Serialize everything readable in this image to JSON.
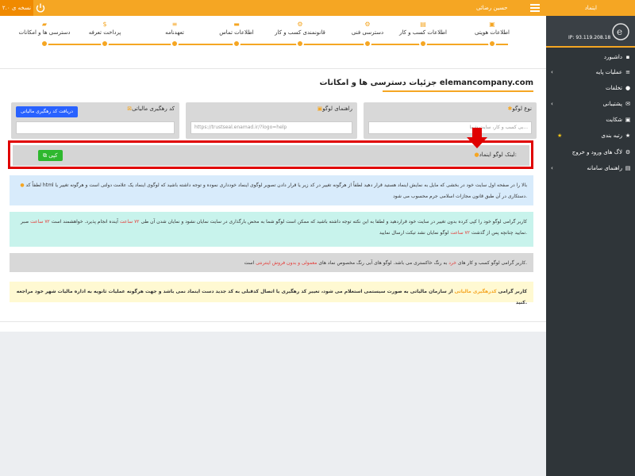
{
  "topbar": {
    "version": "نسخه ی ۲.۰",
    "user": "حسین رضائی"
  },
  "sidebar": {
    "title": "ایتماد",
    "ip": "IP: 93.119.208.18",
    "items": [
      {
        "label": "داشبورد",
        "icon": "▪",
        "icon_name": "dashboard-icon"
      },
      {
        "label": "عملیات پایه",
        "icon": "≡",
        "icon_name": "list-icon",
        "chevron": true
      },
      {
        "label": "تخلفات",
        "icon": "●",
        "icon_name": "alert-icon"
      },
      {
        "label": "پشتیبانی",
        "icon": "✉",
        "icon_name": "message-icon",
        "chevron": true
      },
      {
        "label": "شکایت",
        "icon": "▣",
        "icon_name": "complaint-icon"
      },
      {
        "label": "رتبه بندی",
        "icon": "★",
        "icon_name": "star-icon",
        "star": true
      },
      {
        "label": "لاگ های ورود و خروج",
        "icon": "⚙",
        "icon_name": "log-icon"
      },
      {
        "label": "راهنمای سامانه",
        "icon": "▤",
        "icon_name": "guide-icon",
        "chevron": true
      }
    ]
  },
  "steps": [
    {
      "label": "اطلاعات هویتی",
      "icon": "▣"
    },
    {
      "label": "اطلاعات کسب و کار",
      "icon": "▤"
    },
    {
      "label": "دسترسی فنی",
      "icon": "⚙"
    },
    {
      "label": "قانونمندی کسب و کار",
      "icon": "⚙"
    },
    {
      "label": "اطلاعات تماس",
      "icon": "▬"
    },
    {
      "label": "تعهدنامه",
      "icon": "≡"
    },
    {
      "label": "پرداخت تعرفه",
      "icon": "$"
    },
    {
      "label": "دسترسی ها و امکانات",
      "icon": "▰"
    }
  ],
  "page": {
    "title": "جزئیات دسترسی ها و امکانات elemancompany.com"
  },
  "fields": {
    "logo_type_label": "نوع لوگو",
    "logo_type_value": "بی کسب و کار، سایت شما...",
    "logo_guide_label": "راهنمای لوگو",
    "logo_guide_value": "https://trustseal.enamad.ir/?logo=help",
    "tax_code_label": "کد رهگیری مالیاتی",
    "tax_code_button": "دریافت کد رهگیری مالیاتی",
    "copy_label": "لینک لوگو اینماد:",
    "copy_button": "کپی"
  },
  "messages": {
    "m1": "لطفاً کد html بالا را در صفحه اول سایت خود در بخشی که مایل به نمایش اینماد هستید قرار دهید لطفاً از هرگونه تغییر در کد زیر یا قرار دادن تصویر لوگوی اینماد خودداری نموده و توجه داشته باشید که لوگوی اینماد یک علامت دولتی است و هرگونه تغییر یا دستکاری در آن طبق قانون مجازات اسلامی جرم محسوب می شود.",
    "m2a": "کاربر گرامی لوگو خود را کپی کرده بدون تغییر در سایت خود قراردهید و لطفا به این نکته توجه داشته باشید که ممکن است لوگو شما به محض بارگذاری در سایت نمایان نشود و نمایان شدن آن طی",
    "m2_hours": "۷۲ ساعت",
    "m2b": "آینده انجام پذیرد. خواهشمند است",
    "m2_hours2": "۷۲ ساعت",
    "m2c": "صبر نمایید چنانچه پس از گذشت",
    "m2_hours3": "۷۲ ساعت",
    "m2d": "لوگو نمایان نشد تیکت ارسال نمایید.",
    "m3a": "کاربر گرامی لوگو کسب و کار های",
    "m3_red": "خرد",
    "m3b": "به رنگ خاکستری می باشد. لوگو های آبی رنگ مخصوص نماد های",
    "m3_red2": "معمولی و بدون فروش اینترنتی",
    "m3c": "است.",
    "m4a": "کاربر گرامی",
    "m4_orange": "کدرهگیری مالیاتی",
    "m4b": "از سازمان مالیاتی به صورت سیستمی استعلام می شود، تغییر کد رهگیری یا اتصال کدقبلی به کد جدید دست اینماد نمی باشد و جهت هرگونه عملیات ثانویه به اداره مالیات شهر خود مراجعه کنید."
  },
  "colors": {
    "accent": "#f5a623",
    "sidebar": "#2f3539",
    "highlight": "#e00000",
    "copy_button": "#2eb82e",
    "tax_button": "#2962ff"
  }
}
